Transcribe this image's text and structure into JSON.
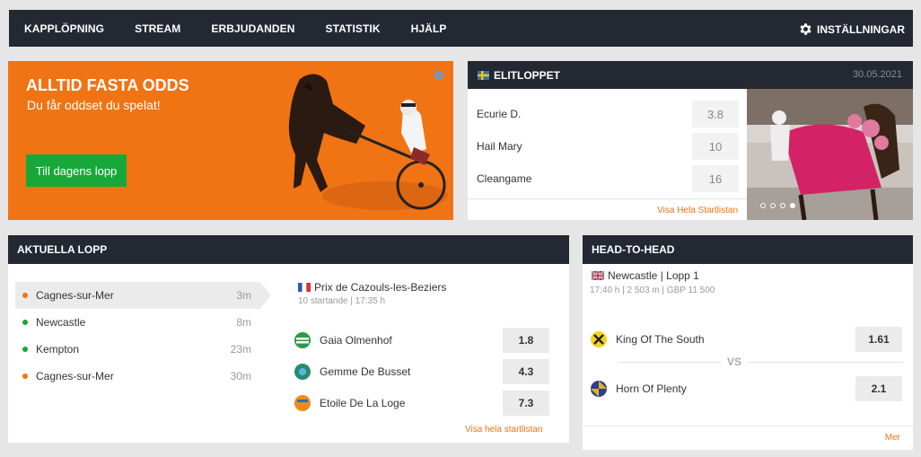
{
  "nav": {
    "items": [
      "KAPPLÖPNING",
      "STREAM",
      "ERBJUDANDEN",
      "STATISTIK",
      "HJÄLP"
    ],
    "settings_label": "INSTÄLLNINGAR"
  },
  "promo": {
    "title": "ALLTID FASTA ODDS",
    "subtitle": "Du får oddset du spelat!",
    "button_label": "Till dagens lopp",
    "color": "#f07314",
    "button_color": "#18a83a"
  },
  "elitloppet": {
    "title": "ELITLOPPET",
    "date": "30.05.2021",
    "runners": [
      {
        "name": "Ecurie D.",
        "odds": "3.8"
      },
      {
        "name": "Hail Mary",
        "odds": "10"
      },
      {
        "name": "Cleangame",
        "odds": "16"
      }
    ],
    "link": "Visa Hela Startlistan",
    "slides_total": 4,
    "active_slide": 4
  },
  "aktuella": {
    "title": "AKTUELLA LOPP",
    "races": [
      {
        "name": "Cagnes-sur-Mer",
        "time": "3m",
        "dot_color": "#f07314",
        "selected": true
      },
      {
        "name": "Newcastle",
        "time": "8m",
        "dot_color": "#18a83a",
        "selected": false
      },
      {
        "name": "Kempton",
        "time": "23m",
        "dot_color": "#18a83a",
        "selected": false
      },
      {
        "name": "Cagnes-sur-Mer",
        "time": "30m",
        "dot_color": "#f07314",
        "selected": false
      }
    ],
    "detail": {
      "title": "Prix de Cazouls-les-Beziers",
      "sub": "10 startande | 17:35 h",
      "runners": [
        {
          "name": "Gaia Olmenhof",
          "odds": "1.8"
        },
        {
          "name": "Gemme De Busset",
          "odds": "4.3"
        },
        {
          "name": "Etoile De La Loge",
          "odds": "7.3"
        }
      ],
      "link": "Visa hela startlistan"
    }
  },
  "h2h": {
    "title": "HEAD-TO-HEAD",
    "race": "Newcastle | Lopp 1",
    "sub": "17:40 h | 2 503 m | GBP 11 500",
    "runners": [
      {
        "name": "King Of The South",
        "odds": "1.61"
      },
      {
        "name": "Horn Of Plenty",
        "odds": "2.1"
      }
    ],
    "vs": "VS",
    "link": "Mer"
  }
}
